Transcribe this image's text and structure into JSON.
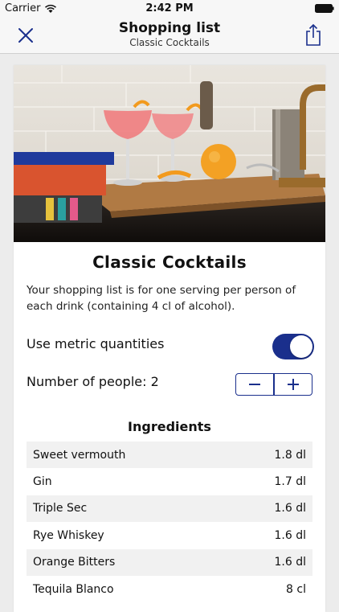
{
  "status_bar": {
    "carrier": "Carrier",
    "time": "2:42 PM"
  },
  "nav": {
    "title": "Shopping list",
    "subtitle": "Classic Cocktails"
  },
  "card": {
    "title": "Classic Cocktails",
    "description": "Your shopping list is for one serving per person of each drink (containing 4 cl of alcohol).",
    "metric_label": "Use metric quantities",
    "metric_enabled": true,
    "people_label": "Number of people: 2",
    "ingredients_heading": "Ingredients",
    "ingredients": [
      {
        "name": "Sweet vermouth",
        "qty": "1.8 dl"
      },
      {
        "name": "Gin",
        "qty": "1.7 dl"
      },
      {
        "name": "Triple Sec",
        "qty": "1.6 dl"
      },
      {
        "name": "Rye Whiskey",
        "qty": "1.6 dl"
      },
      {
        "name": "Orange Bitters",
        "qty": "1.6 dl"
      },
      {
        "name": "Tequila Blanco",
        "qty": "8 cl"
      }
    ]
  },
  "colors": {
    "accent": "#1a2f8c"
  }
}
